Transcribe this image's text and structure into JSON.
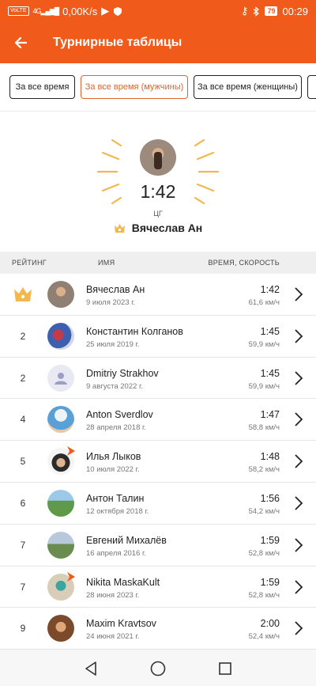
{
  "status_bar": {
    "network_tag": "VoLTE",
    "signal": "4G",
    "speed": "0,00K/s",
    "battery": "79",
    "time": "00:29"
  },
  "app_bar": {
    "title": "Турнирные таблицы",
    "back_icon": "arrow-left-icon"
  },
  "filters": [
    {
      "label": "За все время",
      "active": false
    },
    {
      "label": "За все время (мужчины)",
      "active": true
    },
    {
      "label": "За все время (женщины)",
      "active": false
    },
    {
      "label": "",
      "active": false
    }
  ],
  "leader": {
    "time": "1:42",
    "badge": "ЦГ",
    "name": "Вячеслав Ан"
  },
  "columns": {
    "rank": "РЕЙТИНГ",
    "name": "ИМЯ",
    "time_speed": "ВРЕМЯ, СКОРОСТЬ"
  },
  "rows": [
    {
      "rank": "",
      "crown": true,
      "name": "Вячеслав Ан",
      "date": "9 июля 2023 г.",
      "time": "1:42",
      "speed": "61,6 км/ч"
    },
    {
      "rank": "2",
      "name": "Константин Колганов",
      "date": "25 июля 2019 г.",
      "time": "1:45",
      "speed": "59,9 км/ч"
    },
    {
      "rank": "2",
      "name": "Dmitriy Strakhov",
      "date": "9 августа 2022 г.",
      "time": "1:45",
      "speed": "59,9 км/ч"
    },
    {
      "rank": "4",
      "name": "Anton Sverdlov",
      "date": "28 апреля 2018 г.",
      "time": "1:47",
      "speed": "58,8 км/ч"
    },
    {
      "rank": "5",
      "name": "Илья Лыков",
      "date": "10 июля 2022 г.",
      "time": "1:48",
      "speed": "58,2 км/ч"
    },
    {
      "rank": "6",
      "name": "Антон Талин",
      "date": "12 октября 2018 г.",
      "time": "1:56",
      "speed": "54,2 км/ч"
    },
    {
      "rank": "7",
      "name": "Евгений Михалёв",
      "date": "16 апреля 2016 г.",
      "time": "1:59",
      "speed": "52,8 км/ч"
    },
    {
      "rank": "7",
      "name": "Nikita MaskaKult",
      "date": "28 июня 2023 г.",
      "time": "1:59",
      "speed": "52,8 км/ч"
    },
    {
      "rank": "9",
      "name": "Maxim Kravtsov",
      "date": "24 июня 2021 г.",
      "time": "2:00",
      "speed": "52,4 км/ч"
    }
  ],
  "colors": {
    "brand": "#f05a1a",
    "accent": "#e0632d",
    "gold": "#f2b84b"
  }
}
